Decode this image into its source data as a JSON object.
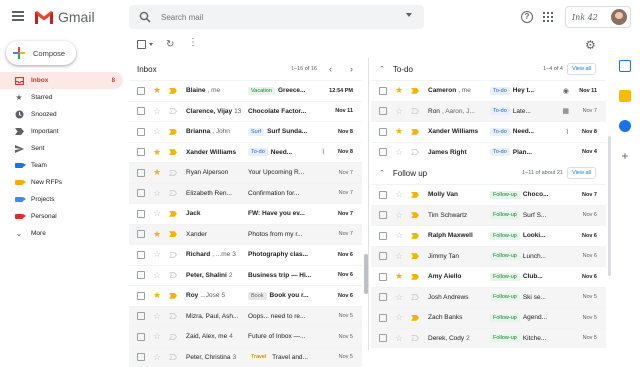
{
  "app": {
    "name": "Gmail",
    "brand_script": "Ink 42",
    "search_placeholder": "Search mail"
  },
  "colors": {
    "gmail_red": "#ea4335",
    "star_yellow": "#f4b400",
    "accent_blue": "#1a73e8"
  },
  "compose": {
    "label": "Compose"
  },
  "sidebar": {
    "items": [
      {
        "label": "Inbox",
        "icon": "inbox-icon",
        "count": "8",
        "active": true
      },
      {
        "label": "Starred",
        "icon": "star-icon",
        "count": ""
      },
      {
        "label": "Snoozed",
        "icon": "clock-icon",
        "count": ""
      },
      {
        "label": "Important",
        "icon": "important-icon",
        "count": ""
      },
      {
        "label": "Sent",
        "icon": "send-icon",
        "count": ""
      },
      {
        "label": "Team",
        "icon": "label-icon",
        "color": "#1a73e8",
        "count": ""
      },
      {
        "label": "New RFPs",
        "icon": "label-icon",
        "color": "#f9ab00",
        "count": ""
      },
      {
        "label": "Projects",
        "icon": "label-icon",
        "color": "#4285f4",
        "count": ""
      },
      {
        "label": "Personal",
        "icon": "label-icon",
        "color": "#d93025",
        "count": ""
      },
      {
        "label": "More",
        "icon": "chevron-down-icon",
        "count": ""
      }
    ]
  },
  "inbox": {
    "title": "Inbox",
    "range": "1–16 of 16",
    "rows": [
      {
        "sender": "Blaine",
        "sender2": ", me",
        "cnt": "",
        "chip": "Vacation",
        "chip_type": "vacation",
        "subject": "Greece...",
        "date": "12:54 PM",
        "unread": true,
        "starred": true,
        "important": true,
        "clip": ""
      },
      {
        "sender": "Clarence, Vijay",
        "cnt": "13",
        "chip": "",
        "subject": "Chocolate Factor...",
        "date": "Nov 11",
        "unread": true,
        "starred": false,
        "important": false,
        "clip": ""
      },
      {
        "sender": "Brianna",
        "sender2": ", John",
        "cnt": "",
        "chip": "Surf",
        "chip_type": "surf",
        "subject": "Surf Sunda...",
        "date": "Nov 8",
        "unread": true,
        "starred": false,
        "important": true,
        "clip": ""
      },
      {
        "sender": "Xander Williams",
        "cnt": "",
        "chip": "To-do",
        "chip_type": "todo",
        "subject": "Need...",
        "date": "Nov 8",
        "unread": true,
        "starred": true,
        "important": true,
        "clip": "📎"
      },
      {
        "sender": "Ryan Alperson",
        "cnt": "",
        "chip": "",
        "subject": "Your Upcoming R...",
        "date": "Nov 7",
        "unread": false,
        "starred": true,
        "important": false,
        "clip": ""
      },
      {
        "sender": "Elizabeth Ren...",
        "cnt": "",
        "chip": "",
        "subject": "Confirmation for...",
        "date": "Nov 7",
        "unread": false,
        "starred": false,
        "important": false,
        "clip": ""
      },
      {
        "sender": "Jack",
        "cnt": "",
        "chip": "",
        "subject": "FW: Have you ev...",
        "date": "Nov 7",
        "unread": true,
        "starred": false,
        "important": true,
        "clip": ""
      },
      {
        "sender": "Xander",
        "cnt": "",
        "chip": "",
        "subject": "Photos from my r...",
        "date": "Nov 7",
        "unread": false,
        "starred": true,
        "important": true,
        "clip": ""
      },
      {
        "sender": "Richard",
        "sender2": ", ...me",
        "cnt": "3",
        "chip": "",
        "subject": "Photography clas...",
        "date": "Nov 6",
        "unread": true,
        "starred": false,
        "important": false,
        "clip": ""
      },
      {
        "sender": "Peter, Shalini",
        "cnt": "2",
        "chip": "",
        "subject": "Business trip — Hi...",
        "date": "Nov 6",
        "unread": true,
        "starred": false,
        "important": false,
        "clip": ""
      },
      {
        "sender": "Roy",
        "sender2": "...Jose",
        "cnt": "5",
        "chip": "Book",
        "chip_type": "book",
        "subject": "Book you r...",
        "date": "Nov 6",
        "unread": true,
        "starred": true,
        "important": true,
        "clip": ""
      },
      {
        "sender": "Mizra, Paul, Ash...",
        "cnt": "",
        "chip": "",
        "subject": "Oops... need to re...",
        "date": "Nov 5",
        "unread": false,
        "starred": false,
        "important": false,
        "clip": ""
      },
      {
        "sender": "Zaid, Alex, me",
        "cnt": "4",
        "chip": "",
        "subject": "Future of Inbox —...",
        "date": "Nov 5",
        "unread": false,
        "starred": false,
        "important": false,
        "clip": ""
      },
      {
        "sender": "Peter, Christina",
        "cnt": "3",
        "chip": "Travel",
        "chip_type": "travel",
        "subject": "Travel and...",
        "date": "Nov 5",
        "unread": false,
        "starred": false,
        "important": false,
        "clip": ""
      }
    ]
  },
  "todo": {
    "title": "To-do",
    "range": "1–4 of 4",
    "view_all": "View all",
    "rows": [
      {
        "sender": "Cameron",
        "sender2": ", me",
        "chip": "To-do",
        "chip_type": "todo",
        "subject": "Hey t...",
        "date": "Nov 11",
        "unread": true,
        "starred": true,
        "important": true,
        "icon": "👁"
      },
      {
        "sender": "Ron",
        "sender2": ", Aaron, J...",
        "chip": "To-do",
        "chip_type": "todo",
        "subject": "Late...",
        "date": "Nov 7",
        "unread": false,
        "starred": false,
        "important": false,
        "icon": "📅"
      },
      {
        "sender": "Xander Williams",
        "chip": "To-do",
        "chip_type": "todo",
        "subject": "Need...",
        "date": "Nov 8",
        "unread": true,
        "starred": true,
        "important": true,
        "icon": "📎"
      },
      {
        "sender": "James Right",
        "chip": "To-do",
        "chip_type": "todo",
        "subject": "Plan...",
        "date": "Nov 4",
        "unread": true,
        "starred": false,
        "important": false,
        "icon": ""
      }
    ]
  },
  "followup": {
    "title": "Follow up",
    "range": "1–11 of about 21",
    "view_all": "View all",
    "rows": [
      {
        "sender": "Molly Van",
        "chip": "Follow-up",
        "chip_type": "followup",
        "subject": "Choco...",
        "date": "Nov 7",
        "unread": true,
        "starred": false,
        "important": true
      },
      {
        "sender": "Tim Schwartz",
        "chip": "Follow-up",
        "chip_type": "followup",
        "subject": "Surf S...",
        "date": "Nov 6",
        "unread": false,
        "starred": false,
        "important": true
      },
      {
        "sender": "Ralph Maxwell",
        "chip": "Follow-up",
        "chip_type": "followup",
        "subject": "Looki...",
        "date": "Nov 6",
        "unread": true,
        "starred": false,
        "important": true
      },
      {
        "sender": "Jimmy Tan",
        "chip": "Follow-up",
        "chip_type": "followup",
        "subject": "Lunch...",
        "date": "Nov 6",
        "unread": false,
        "starred": false,
        "important": true
      },
      {
        "sender": "Amy Aiello",
        "chip": "Follow-up",
        "chip_type": "followup",
        "subject": "Club...",
        "date": "Nov 6",
        "unread": true,
        "starred": true,
        "important": true
      },
      {
        "sender": "Josh Andrews",
        "chip": "Follow-up",
        "chip_type": "followup",
        "subject": "Ski se...",
        "date": "Nov 5",
        "unread": false,
        "starred": false,
        "important": false
      },
      {
        "sender": "Zach Banks",
        "chip": "Follow-up",
        "chip_type": "followup",
        "subject": "Agend...",
        "date": "Nov 5",
        "unread": false,
        "starred": false,
        "important": true
      },
      {
        "sender": "Derek, Cody",
        "cnt": "2",
        "chip": "Follow-up",
        "chip_type": "followup",
        "subject": "Kitche...",
        "date": "Nov 5",
        "unread": false,
        "starred": false,
        "important": false
      }
    ]
  }
}
